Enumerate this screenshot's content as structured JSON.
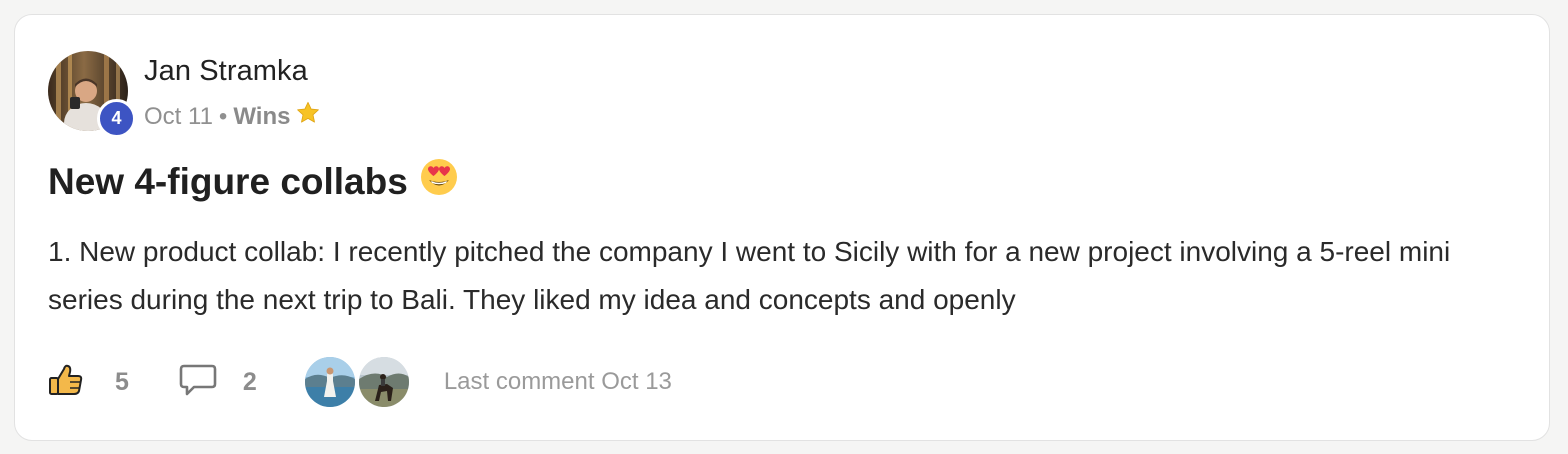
{
  "post": {
    "author": {
      "name": "Jan Stramka",
      "level": "4"
    },
    "date": "Oct 11",
    "separator": "•",
    "category": "Wins",
    "category_icon": "star-icon",
    "title": "New 4-figure collabs",
    "title_emoji": "heart-eyes-emoji-icon",
    "body": "1. New product collab: I recently pitched the company I went to Sicily with for a new project involving a 5-reel mini series during the next trip to Bali. They liked my idea and concepts and openly"
  },
  "footer": {
    "like_icon": "thumbs-up-icon",
    "likes": "5",
    "comment_icon": "comment-bubble-icon",
    "comments": "2",
    "last_comment": "Last comment Oct 13"
  },
  "colors": {
    "badge": "#3d54c3",
    "star": "#f7c325",
    "like_icon": "#f3b84a",
    "muted_text": "#909090"
  }
}
